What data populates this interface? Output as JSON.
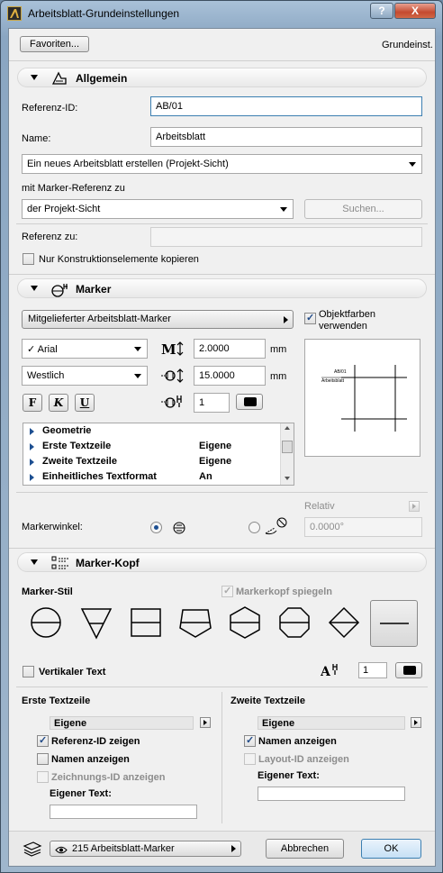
{
  "window": {
    "title": "Arbeitsblatt-Grundeinstellungen",
    "help_label": "?",
    "close_label": "X"
  },
  "top": {
    "favorites_label": "Favoriten...",
    "mode_label": "Grundeinst."
  },
  "allgemein": {
    "title": "Allgemein",
    "refid_label": "Referenz-ID:",
    "refid_value": "AB/01",
    "name_label": "Name:",
    "name_value": "Arbeitsblatt",
    "create_option": "Ein neues Arbeitsblatt erstellen (Projekt-Sicht)",
    "marker_ref_label": "mit Marker-Referenz zu",
    "marker_ref_option": "der Projekt-Sicht",
    "search_label": "Suchen...",
    "ref_to_label": "Referenz zu:",
    "ref_to_value": "",
    "copy_label": "Nur Konstruktionselemente kopieren"
  },
  "marker": {
    "title": "Marker",
    "type_option": "Mitgelieferter Arbeitsblatt-Marker",
    "obj_colors_label": "Objektfarben verwenden",
    "font": "✓ Arial",
    "charset": "Westlich",
    "size_value": "2.0000",
    "size_unit": "mm",
    "offset_value": "15.0000",
    "offset_unit": "mm",
    "pen_value": "1",
    "fmt_bold": "F",
    "fmt_italic": "K",
    "fmt_underline": "U",
    "preview_ref": "AB/01",
    "preview_name": "Arbeitsblatt",
    "params": [
      {
        "key": "Geometrie",
        "value": ""
      },
      {
        "key": "Erste Textzeile",
        "value": "Eigene"
      },
      {
        "key": "Zweite Textzeile",
        "value": "Eigene"
      },
      {
        "key": "Einheitliches Textformat",
        "value": "An"
      }
    ],
    "relativ_label": "Relativ",
    "angle_label": "Markerwinkel:",
    "angle_value": "0.0000°"
  },
  "marker_kopf": {
    "title": "Marker-Kopf",
    "style_label": "Marker-Stil",
    "mirror_label": "Markerkopf spiegeln",
    "symbols": [
      "circle-split",
      "triangle-down",
      "square-split",
      "pentagon",
      "hexagon",
      "octagon",
      "diamond",
      "line"
    ],
    "vertical_text_label": "Vertikaler Text",
    "pen_value": "1",
    "first": {
      "title": "Erste Textzeile",
      "option": "Eigene",
      "show_refid": "Referenz-ID zeigen",
      "show_name": "Namen anzeigen",
      "show_drawing_id": "Zeichnungs-ID anzeigen",
      "custom_label": "Eigener Text:",
      "custom_value": ""
    },
    "second": {
      "title": "Zweite Textzeile",
      "option": "Eigene",
      "show_name": "Namen anzeigen",
      "show_layout_id": "Layout-ID anzeigen",
      "custom_label": "Eigener Text:",
      "custom_value": ""
    }
  },
  "footer": {
    "layer_option": "215 Arbeitsblatt-Marker",
    "cancel_label": "Abbrechen",
    "ok_label": "OK"
  },
  "colors": {
    "accent": "#3c7fb1",
    "title_bg": "#9fb6cc"
  }
}
